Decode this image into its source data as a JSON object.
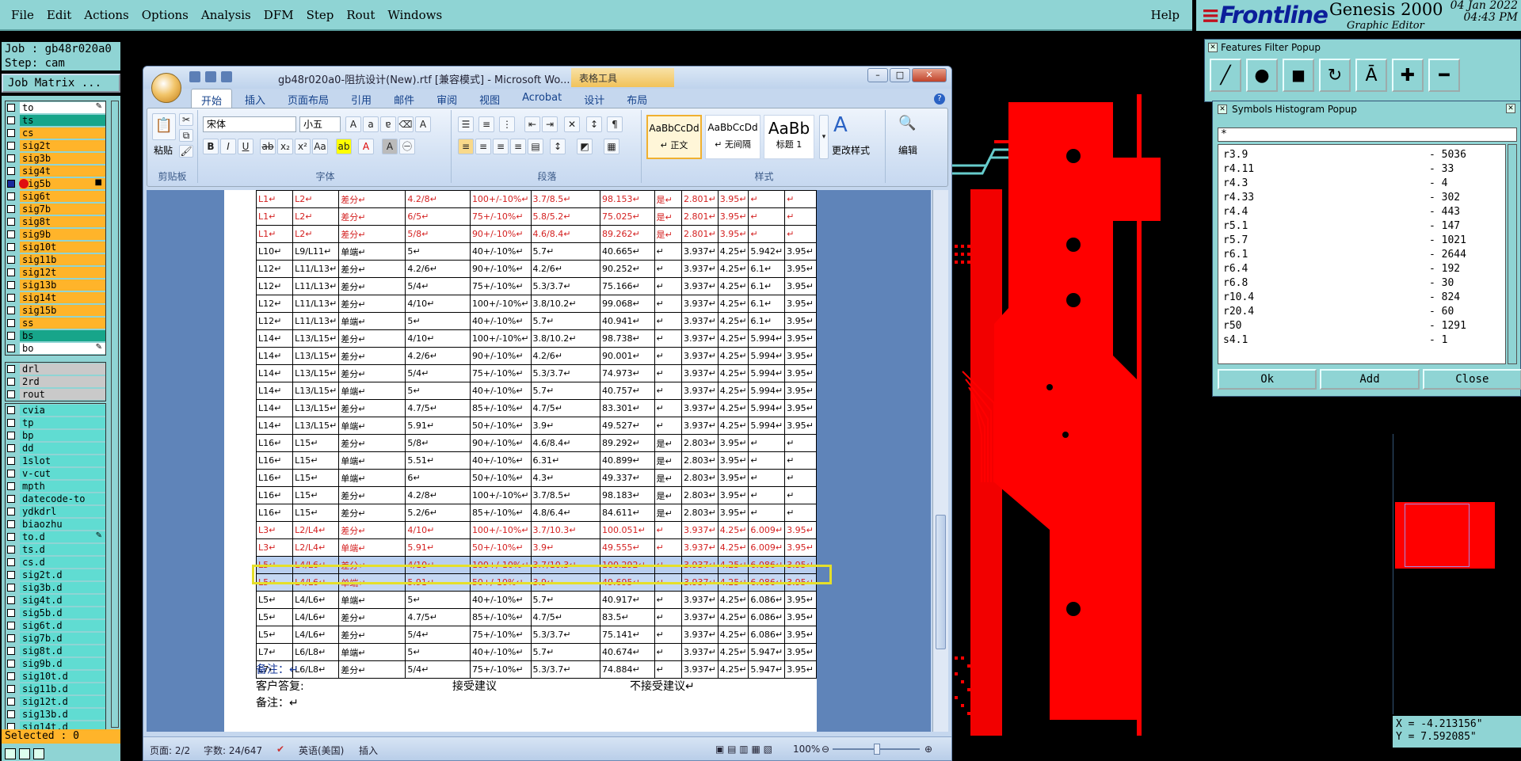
{
  "genesis": {
    "menus": [
      "File",
      "Edit",
      "Actions",
      "Options",
      "Analysis",
      "DFM",
      "Step",
      "Rout",
      "Windows"
    ],
    "help": "Help",
    "brand": "Frontline",
    "product": "Genesis 2000",
    "product_sub": "Graphic Editor",
    "date": "04 Jan 2022",
    "time": "04:43 PM",
    "job_line": "Job : gb48r020a0",
    "step_line": "Step: cam",
    "job_matrix_btn": "Job Matrix ...",
    "layers_group1": [
      {
        "name": "to",
        "color": "white",
        "mark": "✎"
      },
      {
        "name": "ts",
        "color": "green"
      },
      {
        "name": "cs",
        "color": "orange"
      },
      {
        "name": "sig2t",
        "color": "orange"
      },
      {
        "name": "sig3b",
        "color": "orange"
      },
      {
        "name": "sig4t",
        "color": "orange"
      },
      {
        "name": "sig5b",
        "color": "orange",
        "active": true,
        "mark": "■"
      },
      {
        "name": "sig6t",
        "color": "orange"
      },
      {
        "name": "sig7b",
        "color": "orange"
      },
      {
        "name": "sig8t",
        "color": "orange"
      },
      {
        "name": "sig9b",
        "color": "orange"
      },
      {
        "name": "sig10t",
        "color": "orange"
      },
      {
        "name": "sig11b",
        "color": "orange"
      },
      {
        "name": "sig12t",
        "color": "orange"
      },
      {
        "name": "sig13b",
        "color": "orange"
      },
      {
        "name": "sig14t",
        "color": "orange"
      },
      {
        "name": "sig15b",
        "color": "orange"
      },
      {
        "name": "ss",
        "color": "orange"
      },
      {
        "name": "bs",
        "color": "green"
      },
      {
        "name": "bo",
        "color": "white",
        "mark": "✎"
      }
    ],
    "layers_group2": [
      {
        "name": "drl",
        "color": "grey"
      },
      {
        "name": "2rd",
        "color": "grey"
      },
      {
        "name": "rout",
        "color": "grey"
      }
    ],
    "layers_group3": [
      {
        "name": "cvia",
        "color": "cyan"
      },
      {
        "name": "tp",
        "color": "cyan"
      },
      {
        "name": "bp",
        "color": "cyan"
      },
      {
        "name": "dd",
        "color": "cyan"
      },
      {
        "name": "1slot",
        "color": "cyan"
      },
      {
        "name": "v-cut",
        "color": "cyan"
      },
      {
        "name": "mpth",
        "color": "cyan"
      },
      {
        "name": "datecode-to",
        "color": "cyan"
      },
      {
        "name": "ydkdrl",
        "color": "cyan"
      },
      {
        "name": "biaozhu",
        "color": "cyan"
      },
      {
        "name": "to.d",
        "color": "cyan",
        "mark": "✎"
      },
      {
        "name": "ts.d",
        "color": "cyan"
      },
      {
        "name": "cs.d",
        "color": "cyan"
      },
      {
        "name": "sig2t.d",
        "color": "cyan"
      },
      {
        "name": "sig3b.d",
        "color": "cyan"
      },
      {
        "name": "sig4t.d",
        "color": "cyan"
      },
      {
        "name": "sig5b.d",
        "color": "cyan"
      },
      {
        "name": "sig6t.d",
        "color": "cyan"
      },
      {
        "name": "sig7b.d",
        "color": "cyan"
      },
      {
        "name": "sig8t.d",
        "color": "cyan"
      },
      {
        "name": "sig9b.d",
        "color": "cyan"
      },
      {
        "name": "sig10t.d",
        "color": "cyan"
      },
      {
        "name": "sig11b.d",
        "color": "cyan"
      },
      {
        "name": "sig12t.d",
        "color": "cyan"
      },
      {
        "name": "sig13b.d",
        "color": "cyan"
      },
      {
        "name": "sig14t.d",
        "color": "cyan"
      }
    ],
    "selected": "Selected : 0",
    "features_popup_title": "Features Filter Popup",
    "hist_popup_title": "Symbols Histogram Popup",
    "hist_filter": "*",
    "hist_rows": [
      {
        "sym": "r3.9",
        "count": "- 5036"
      },
      {
        "sym": "r4.11",
        "count": "- 33"
      },
      {
        "sym": "r4.3",
        "count": "- 4"
      },
      {
        "sym": "r4.33",
        "count": "- 302"
      },
      {
        "sym": "r4.4",
        "count": "- 443"
      },
      {
        "sym": "r5.1",
        "count": "- 147"
      },
      {
        "sym": "r5.7",
        "count": "- 1021"
      },
      {
        "sym": "r6.1",
        "count": "- 2644"
      },
      {
        "sym": "r6.4",
        "count": "- 192"
      },
      {
        "sym": "r6.8",
        "count": "- 30"
      },
      {
        "sym": "r10.4",
        "count": "- 824"
      },
      {
        "sym": "r20.4",
        "count": "- 60"
      },
      {
        "sym": "r50",
        "count": "- 1291"
      },
      {
        "sym": "s4.1",
        "count": "- 1"
      }
    ],
    "hist_ok": "Ok",
    "hist_add": "Add",
    "hist_close": "Close",
    "coord_x": "X = -4.213156\"",
    "coord_y": "Y = 7.592085\""
  },
  "word": {
    "title": "gb48r020a0-阻抗设计(New).rtf [兼容模式] - Microsoft Wo...",
    "table_tools": "表格工具",
    "tabs": [
      "开始",
      "插入",
      "页面布局",
      "引用",
      "邮件",
      "审阅",
      "视图",
      "Acrobat",
      "设计",
      "布局"
    ],
    "groups": {
      "clipboard": "剪贴板",
      "font": "字体",
      "paragraph": "段落",
      "styles": "样式",
      "paste": "粘贴",
      "change_styles": "更改样式",
      "edit": "编辑"
    },
    "font_name": "宋体",
    "font_size": "小五",
    "style_boxes": [
      {
        "sample": "AaBbCcDd",
        "name": "↵ 正文"
      },
      {
        "sample": "AaBbCcDd",
        "name": "↵ 无间隔"
      },
      {
        "sample": "AaBb",
        "name": "标题 1"
      }
    ],
    "rows": [
      {
        "cls": "red",
        "cells": [
          "L1↵",
          "L2↵",
          "差分↵",
          "4.2/8↵",
          "100+/-10%↵",
          "3.7/8.5↵",
          "98.153↵",
          "是↵",
          "2.801↵",
          "3.95↵",
          "↵",
          "↵"
        ]
      },
      {
        "cls": "red",
        "cells": [
          "L1↵",
          "L2↵",
          "差分↵",
          "6/5↵",
          "75+/-10%↵",
          "5.8/5.2↵",
          "75.025↵",
          "是↵",
          "2.801↵",
          "3.95↵",
          "↵",
          "↵"
        ]
      },
      {
        "cls": "red",
        "cells": [
          "L1↵",
          "L2↵",
          "差分↵",
          "5/8↵",
          "90+/-10%↵",
          "4.6/8.4↵",
          "89.262↵",
          "是↵",
          "2.801↵",
          "3.95↵",
          "↵",
          "↵"
        ]
      },
      {
        "cls": "",
        "cells": [
          "L10↵",
          "L9/L11↵",
          "单端↵",
          "5↵",
          "40+/-10%↵",
          "5.7↵",
          "40.665↵",
          "↵",
          "3.937↵",
          "4.25↵",
          "5.942↵",
          "3.95↵"
        ]
      },
      {
        "cls": "",
        "cells": [
          "L12↵",
          "L11/L13↵",
          "差分↵",
          "4.2/6↵",
          "90+/-10%↵",
          "4.2/6↵",
          "90.252↵",
          "↵",
          "3.937↵",
          "4.25↵",
          "6.1↵",
          "3.95↵"
        ]
      },
      {
        "cls": "",
        "cells": [
          "L12↵",
          "L11/L13↵",
          "差分↵",
          "5/4↵",
          "75+/-10%↵",
          "5.3/3.7↵",
          "75.166↵",
          "↵",
          "3.937↵",
          "4.25↵",
          "6.1↵",
          "3.95↵"
        ]
      },
      {
        "cls": "",
        "cells": [
          "L12↵",
          "L11/L13↵",
          "差分↵",
          "4/10↵",
          "100+/-10%↵",
          "3.8/10.2↵",
          "99.068↵",
          "↵",
          "3.937↵",
          "4.25↵",
          "6.1↵",
          "3.95↵"
        ]
      },
      {
        "cls": "",
        "cells": [
          "L12↵",
          "L11/L13↵",
          "单端↵",
          "5↵",
          "40+/-10%↵",
          "5.7↵",
          "40.941↵",
          "↵",
          "3.937↵",
          "4.25↵",
          "6.1↵",
          "3.95↵"
        ]
      },
      {
        "cls": "",
        "cells": [
          "L14↵",
          "L13/L15↵",
          "差分↵",
          "4/10↵",
          "100+/-10%↵",
          "3.8/10.2↵",
          "98.738↵",
          "↵",
          "3.937↵",
          "4.25↵",
          "5.994↵",
          "3.95↵"
        ]
      },
      {
        "cls": "",
        "cells": [
          "L14↵",
          "L13/L15↵",
          "差分↵",
          "4.2/6↵",
          "90+/-10%↵",
          "4.2/6↵",
          "90.001↵",
          "↵",
          "3.937↵",
          "4.25↵",
          "5.994↵",
          "3.95↵"
        ]
      },
      {
        "cls": "",
        "cells": [
          "L14↵",
          "L13/L15↵",
          "差分↵",
          "5/4↵",
          "75+/-10%↵",
          "5.3/3.7↵",
          "74.973↵",
          "↵",
          "3.937↵",
          "4.25↵",
          "5.994↵",
          "3.95↵"
        ]
      },
      {
        "cls": "",
        "cells": [
          "L14↵",
          "L13/L15↵",
          "单端↵",
          "5↵",
          "40+/-10%↵",
          "5.7↵",
          "40.757↵",
          "↵",
          "3.937↵",
          "4.25↵",
          "5.994↵",
          "3.95↵"
        ]
      },
      {
        "cls": "",
        "cells": [
          "L14↵",
          "L13/L15↵",
          "差分↵",
          "4.7/5↵",
          "85+/-10%↵",
          "4.7/5↵",
          "83.301↵",
          "↵",
          "3.937↵",
          "4.25↵",
          "5.994↵",
          "3.95↵"
        ]
      },
      {
        "cls": "",
        "cells": [
          "L14↵",
          "L13/L15↵",
          "单端↵",
          "5.91↵",
          "50+/-10%↵",
          "3.9↵",
          "49.527↵",
          "↵",
          "3.937↵",
          "4.25↵",
          "5.994↵",
          "3.95↵"
        ]
      },
      {
        "cls": "",
        "cells": [
          "L16↵",
          "L15↵",
          "差分↵",
          "5/8↵",
          "90+/-10%↵",
          "4.6/8.4↵",
          "89.292↵",
          "是↵",
          "2.803↵",
          "3.95↵",
          "↵",
          "↵"
        ]
      },
      {
        "cls": "",
        "cells": [
          "L16↵",
          "L15↵",
          "单端↵",
          "5.51↵",
          "40+/-10%↵",
          "6.31↵",
          "40.899↵",
          "是↵",
          "2.803↵",
          "3.95↵",
          "↵",
          "↵"
        ]
      },
      {
        "cls": "",
        "cells": [
          "L16↵",
          "L15↵",
          "单端↵",
          "6↵",
          "50+/-10%↵",
          "4.3↵",
          "49.337↵",
          "是↵",
          "2.803↵",
          "3.95↵",
          "↵",
          "↵"
        ]
      },
      {
        "cls": "",
        "cells": [
          "L16↵",
          "L15↵",
          "差分↵",
          "4.2/8↵",
          "100+/-10%↵",
          "3.7/8.5↵",
          "98.183↵",
          "是↵",
          "2.803↵",
          "3.95↵",
          "↵",
          "↵"
        ]
      },
      {
        "cls": "",
        "cells": [
          "L16↵",
          "L15↵",
          "差分↵",
          "5.2/6↵",
          "85+/-10%↵",
          "4.8/6.4↵",
          "84.611↵",
          "是↵",
          "2.803↵",
          "3.95↵",
          "↵",
          "↵"
        ]
      },
      {
        "cls": "red",
        "cells": [
          "L3↵",
          "L2/L4↵",
          "差分↵",
          "4/10↵",
          "100+/-10%↵",
          "3.7/10.3↵",
          "100.051↵",
          "↵",
          "3.937↵",
          "4.25↵",
          "6.009↵",
          "3.95↵"
        ]
      },
      {
        "cls": "red",
        "cells": [
          "L3↵",
          "L2/L4↵",
          "单端↵",
          "5.91↵",
          "50+/-10%↵",
          "3.9↵",
          "49.555↵",
          "↵",
          "3.937↵",
          "4.25↵",
          "6.009↵",
          "3.95↵"
        ]
      },
      {
        "cls": "red hl",
        "cells": [
          "L5↵",
          "L4/L6↵",
          "差分↵",
          "4/10↵",
          "100+/-10%↵",
          "3.7/10.3↵",
          "100.292↵",
          "↵",
          "3.937↵",
          "4.25↵",
          "6.086↵",
          "3.95↵"
        ]
      },
      {
        "cls": "red hl2",
        "cells": [
          "L5↵",
          "L4/L6↵",
          "单端↵",
          "5.91↵",
          "50+/-10%↵",
          "3.9↵",
          "49.695↵",
          "↵",
          "3.937↵",
          "4.25↵",
          "6.086↵",
          "3.95↵"
        ]
      },
      {
        "cls": "",
        "cells": [
          "L5↵",
          "L4/L6↵",
          "单端↵",
          "5↵",
          "40+/-10%↵",
          "5.7↵",
          "40.917↵",
          "↵",
          "3.937↵",
          "4.25↵",
          "6.086↵",
          "3.95↵"
        ]
      },
      {
        "cls": "",
        "cells": [
          "L5↵",
          "L4/L6↵",
          "差分↵",
          "4.7/5↵",
          "85+/-10%↵",
          "4.7/5↵",
          "83.5↵",
          "↵",
          "3.937↵",
          "4.25↵",
          "6.086↵",
          "3.95↵"
        ]
      },
      {
        "cls": "",
        "cells": [
          "L5↵",
          "L4/L6↵",
          "差分↵",
          "5/4↵",
          "75+/-10%↵",
          "5.3/3.7↵",
          "75.141↵",
          "↵",
          "3.937↵",
          "4.25↵",
          "6.086↵",
          "3.95↵"
        ]
      },
      {
        "cls": "",
        "cells": [
          "L7↵",
          "L6/L8↵",
          "单端↵",
          "5↵",
          "40+/-10%↵",
          "5.7↵",
          "40.674↵",
          "↵",
          "3.937↵",
          "4.25↵",
          "5.947↵",
          "3.95↵"
        ]
      },
      {
        "cls": "",
        "cells": [
          "L7↵",
          "L6/L8↵",
          "差分↵",
          "5/4↵",
          "75+/-10%↵",
          "5.3/3.7↵",
          "74.884↵",
          "↵",
          "3.937↵",
          "4.25↵",
          "5.947↵",
          "3.95↵"
        ]
      }
    ],
    "remark_label": "备注：↵",
    "customer_reply": "客户答复:",
    "accept": "接受建议",
    "reject": "不接受建议↵",
    "remark_label2": "备注：↵",
    "status": {
      "page": "页面: 2/2",
      "words": "字数: 24/647",
      "lang": "英语(美国)",
      "mode": "插入",
      "zoom": "100%"
    }
  }
}
